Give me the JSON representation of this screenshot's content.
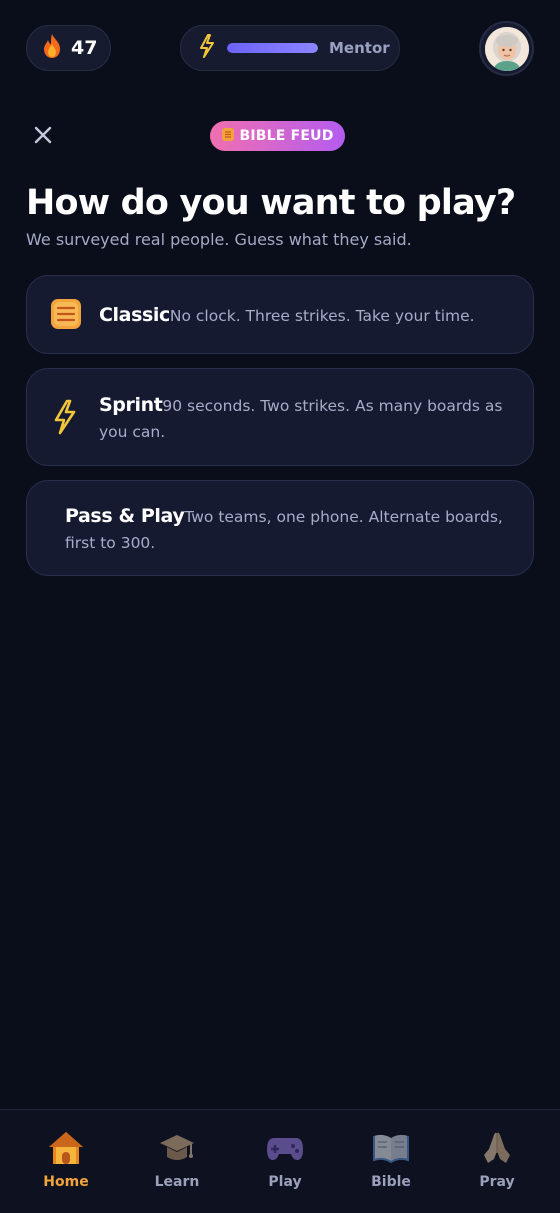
{
  "topbar": {
    "streak_count": "47",
    "xp_progress": 1.0,
    "rank_label": "Mentor"
  },
  "header": {
    "badge_label": "BIBLE FEUD"
  },
  "title": "How do you want to play?",
  "subtitle": "We surveyed real people. Guess what they said.",
  "modes": [
    {
      "name": "Classic",
      "description": "No clock. Three strikes. Take your time.",
      "icon": "scroll-icon"
    },
    {
      "name": "Sprint",
      "description": "90 seconds. Two strikes. As many boards as you can.",
      "icon": "lightning-icon"
    },
    {
      "name": "Pass & Play",
      "description": "Two teams, one phone. Alternate boards, first to 300.",
      "icon": "none"
    }
  ],
  "nav": {
    "items": [
      {
        "label": "Home",
        "icon": "house-icon",
        "active": true
      },
      {
        "label": "Learn",
        "icon": "graduation-cap-icon",
        "active": false
      },
      {
        "label": "Play",
        "icon": "gamepad-icon",
        "active": false
      },
      {
        "label": "Bible",
        "icon": "open-book-icon",
        "active": false
      },
      {
        "label": "Pray",
        "icon": "praying-hands-icon",
        "active": false
      }
    ]
  },
  "colors": {
    "background": "#0a0d1a",
    "card": "#151a30",
    "accent_orange": "#f2a33a",
    "badge_gradient_start": "#f06fb0",
    "badge_gradient_end": "#b45cf0",
    "xp_fill": "#6c63ff"
  }
}
